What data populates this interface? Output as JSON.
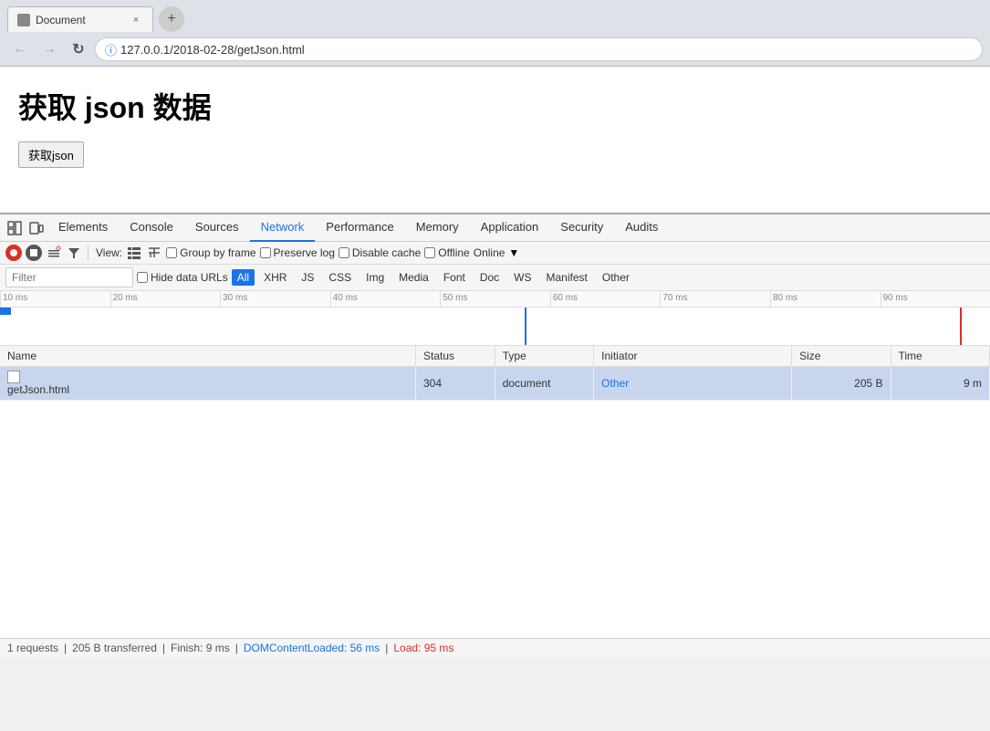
{
  "browser": {
    "tab_title": "Document",
    "tab_favicon": "📄",
    "new_tab_label": "+",
    "close_label": "×",
    "nav_back": "←",
    "nav_forward": "→",
    "nav_refresh": "↻",
    "address": "127.0.0.1/2018-02-28/getJson.html",
    "address_prefix": "127.0.0.1",
    "address_path": "/2018-02-28/getJson.html"
  },
  "page": {
    "title": "获取 json 数据",
    "fetch_button": "获取json"
  },
  "devtools": {
    "tabs": [
      {
        "id": "elements",
        "label": "Elements"
      },
      {
        "id": "console",
        "label": "Console"
      },
      {
        "id": "sources",
        "label": "Sources"
      },
      {
        "id": "network",
        "label": "Network"
      },
      {
        "id": "performance",
        "label": "Performance"
      },
      {
        "id": "memory",
        "label": "Memory"
      },
      {
        "id": "application",
        "label": "Application"
      },
      {
        "id": "security",
        "label": "Security"
      },
      {
        "id": "audits",
        "label": "Audits"
      }
    ],
    "active_tab": "network"
  },
  "network": {
    "toolbar": {
      "view_label": "View:",
      "group_by_frame": "Group by frame",
      "preserve_log": "Preserve log",
      "disable_cache": "Disable cache",
      "offline": "Offline",
      "online": "Online"
    },
    "filter": {
      "placeholder": "Filter",
      "hide_data_urls": "Hide data URLs",
      "types": [
        "All",
        "XHR",
        "JS",
        "CSS",
        "Img",
        "Media",
        "Font",
        "Doc",
        "WS",
        "Manifest",
        "Other"
      ]
    },
    "active_filter": "All",
    "timeline": {
      "ticks": [
        "10 ms",
        "20 ms",
        "30 ms",
        "40 ms",
        "50 ms",
        "60 ms",
        "70 ms",
        "80 ms",
        "90 ms"
      ]
    },
    "table": {
      "headers": [
        "Name",
        "Status",
        "Type",
        "Initiator",
        "Size",
        "Time"
      ],
      "rows": [
        {
          "name": "getJson.html",
          "status": "304",
          "type": "document",
          "initiator": "Other",
          "size": "205 B",
          "time": "9 m"
        }
      ]
    },
    "status_bar": {
      "requests": "1 requests",
      "transferred": "205 B transferred",
      "finish": "Finish: 9 ms",
      "domcontent": "DOMContentLoaded: 56 ms",
      "load": "Load: 95 ms"
    }
  }
}
